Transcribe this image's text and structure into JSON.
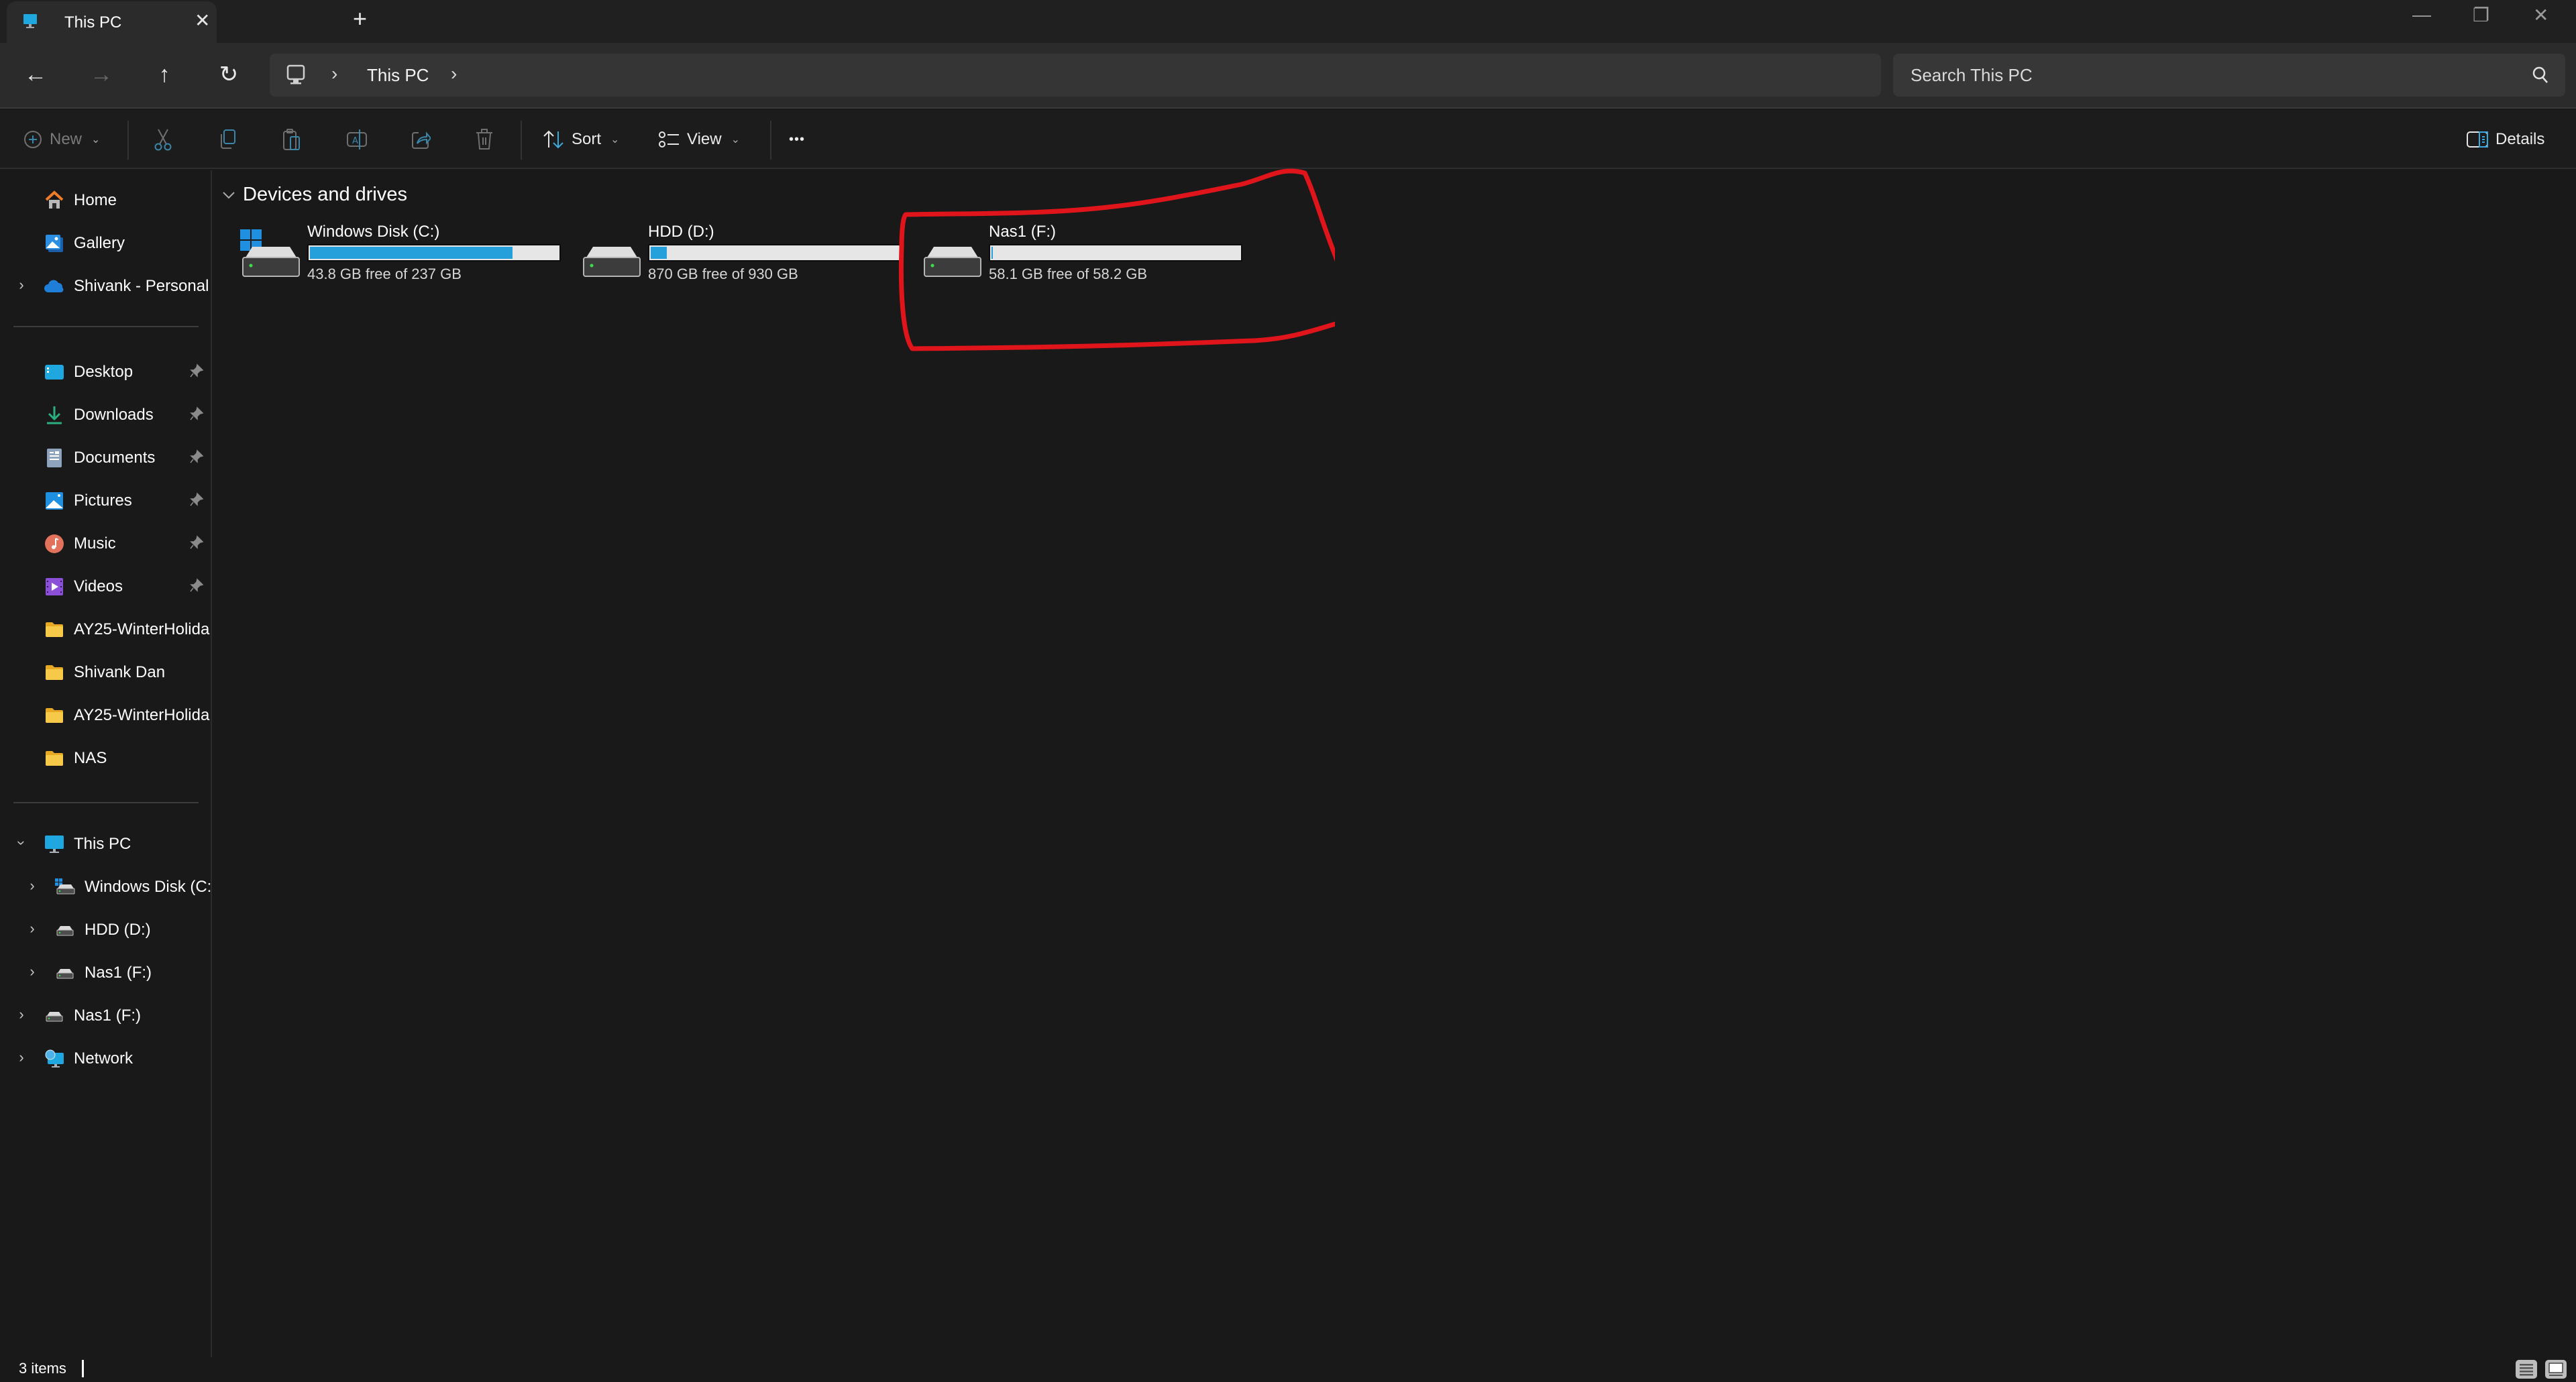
{
  "window": {
    "tab": {
      "label": "This PC",
      "icon": "monitor-icon"
    },
    "new_tab_label": "+",
    "close_tab_label": "✕",
    "controls": {
      "minimize": "—",
      "restore": "❐",
      "close": "✕"
    }
  },
  "nav": {
    "back": "←",
    "forward": "→",
    "up": "↑",
    "refresh": "↻",
    "breadcrumb": [
      {
        "label": "This PC"
      }
    ],
    "chevron": "›"
  },
  "search": {
    "placeholder": "Search This PC",
    "value": ""
  },
  "commandbar": {
    "new_label": "New",
    "sort_label": "Sort",
    "view_label": "View",
    "more_label": "•••",
    "details_label": "Details",
    "caret": "⌄",
    "actions": [
      "Cut",
      "Copy",
      "Paste",
      "Rename",
      "Share",
      "Delete"
    ]
  },
  "sidebar": {
    "top": [
      {
        "label": "Home",
        "icon": "home-icon"
      },
      {
        "label": "Gallery",
        "icon": "gallery-icon"
      },
      {
        "label": "Shivank - Personal",
        "icon": "onedrive-cloud-icon",
        "expandable": true
      }
    ],
    "quick_access": [
      {
        "label": "Desktop",
        "icon": "desktop-icon",
        "pinned": true
      },
      {
        "label": "Downloads",
        "icon": "download-icon",
        "pinned": true
      },
      {
        "label": "Documents",
        "icon": "documents-icon",
        "pinned": true
      },
      {
        "label": "Pictures",
        "icon": "pictures-icon",
        "pinned": true
      },
      {
        "label": "Music",
        "icon": "music-icon",
        "pinned": true
      },
      {
        "label": "Videos",
        "icon": "videos-icon",
        "pinned": true
      },
      {
        "label": "AY25-WinterHolida",
        "icon": "folder-icon"
      },
      {
        "label": "Shivank Dan",
        "icon": "folder-icon"
      },
      {
        "label": "AY25-WinterHolida",
        "icon": "folder-icon"
      },
      {
        "label": "NAS",
        "icon": "folder-icon"
      }
    ],
    "tree": [
      {
        "label": "This PC",
        "icon": "monitor-icon",
        "expanded": true,
        "level": 0
      },
      {
        "label": "Windows Disk (C:)",
        "icon": "windows-drive-icon",
        "level": 1
      },
      {
        "label": "HDD (D:)",
        "icon": "drive-icon",
        "level": 1
      },
      {
        "label": "Nas1 (F:)",
        "icon": "drive-icon",
        "level": 1
      },
      {
        "label": "Nas1 (F:)",
        "icon": "drive-icon",
        "level": 0
      },
      {
        "label": "Network",
        "icon": "network-icon",
        "level": 0
      }
    ]
  },
  "content": {
    "group_title": "Devices and drives",
    "drives": [
      {
        "name": "Windows Disk (C:)",
        "free_text": "43.8 GB free of 237 GB",
        "free_gb": 43.8,
        "total_gb": 237,
        "used_fraction": 0.815,
        "system": true
      },
      {
        "name": "HDD (D:)",
        "free_text": "870 GB free of 930 GB",
        "free_gb": 870,
        "total_gb": 930,
        "used_fraction": 0.065,
        "system": false
      },
      {
        "name": "Nas1 (F:)",
        "free_text": "58.1 GB free of 58.2 GB",
        "free_gb": 58.1,
        "total_gb": 58.2,
        "used_fraction": 0.002,
        "system": false,
        "annotated": true
      }
    ]
  },
  "statusbar": {
    "item_count": "3 items"
  },
  "colors": {
    "accent": "#26a0da",
    "annotation": "#e0141b",
    "folder": "#f5c443",
    "background": "#191919"
  }
}
